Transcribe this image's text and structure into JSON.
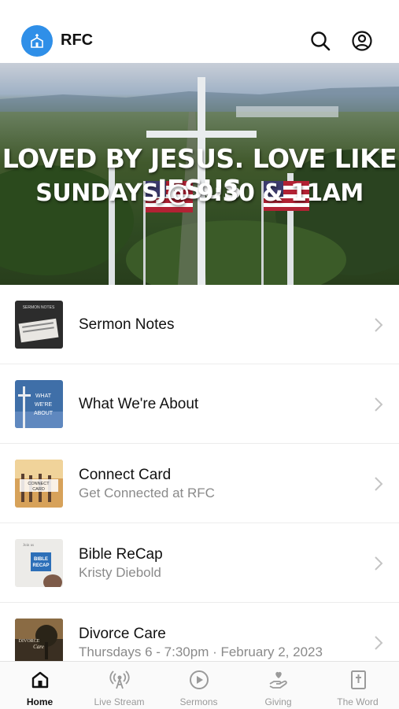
{
  "header": {
    "app_name": "RFC",
    "logo_icon": "church-icon",
    "accent_color": "#2f8fe8"
  },
  "hero": {
    "line1": "LOVED BY JESUS. LOVE LIKE JESUS",
    "line2": "SUNDAYS @ 9:30 & 11AM"
  },
  "items": [
    {
      "title": "Sermon Notes",
      "subtitle": "",
      "thumb_text": "SERMON NOTES"
    },
    {
      "title": "What We're About",
      "subtitle": "",
      "thumb_text": "WHAT WE'RE ABOUT"
    },
    {
      "title": "Connect Card",
      "subtitle": "Get Connected at RFC",
      "thumb_text": "CONNECT CARD"
    },
    {
      "title": "Bible ReCap",
      "subtitle": "Kristy Diebold",
      "thumb_text": "BIBLE RECAP"
    },
    {
      "title": "Divorce Care",
      "subtitle": "Thursdays 6 - 7:30pm · February 2, 2023",
      "thumb_text": "DIVORCE CARE"
    }
  ],
  "tabs": [
    {
      "label": "Home",
      "icon": "home-icon",
      "active": true
    },
    {
      "label": "Live Stream",
      "icon": "broadcast-icon",
      "active": false
    },
    {
      "label": "Sermons",
      "icon": "play-icon",
      "active": false
    },
    {
      "label": "Giving",
      "icon": "giving-hand-icon",
      "active": false
    },
    {
      "label": "The Word",
      "icon": "bible-icon",
      "active": false
    }
  ]
}
